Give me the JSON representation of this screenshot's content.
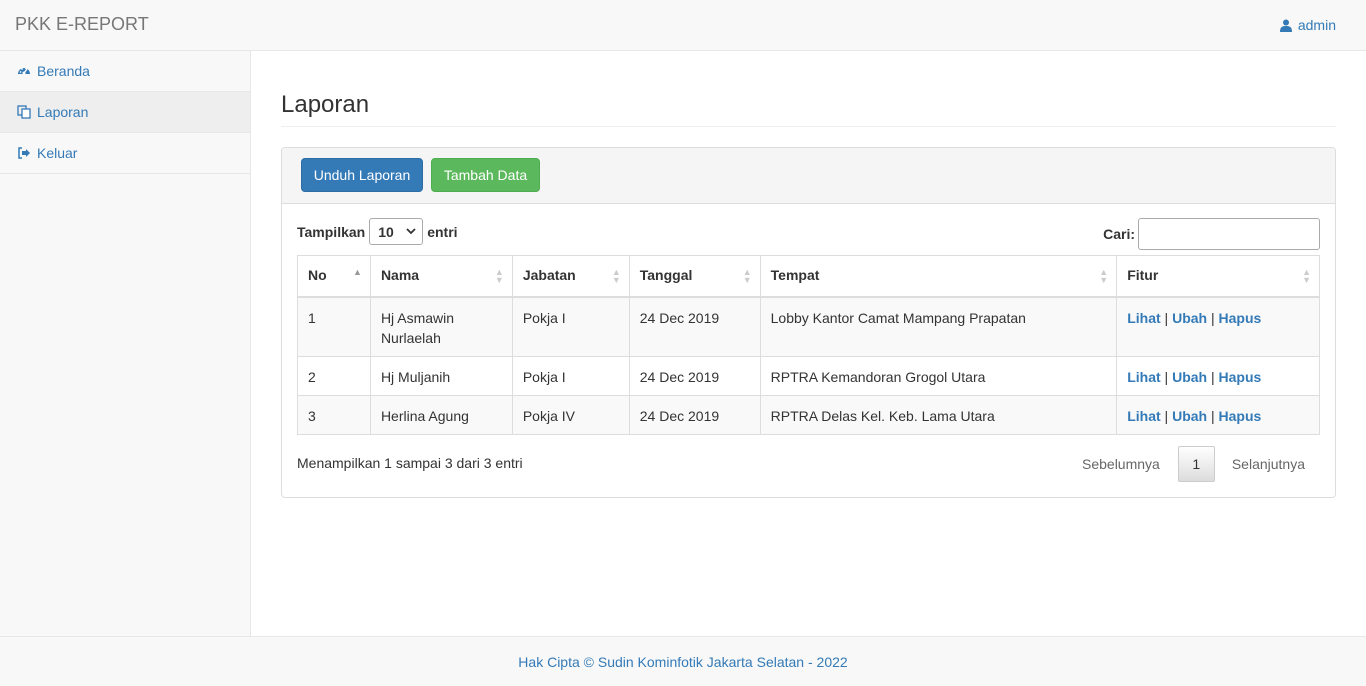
{
  "navbar": {
    "brand": "PKK E-REPORT",
    "user": "admin",
    "user_icon": "user-icon"
  },
  "sidebar": {
    "items": [
      {
        "label": "Beranda",
        "icon": "dashboard-icon"
      },
      {
        "label": "Laporan",
        "icon": "copy-icon"
      },
      {
        "label": "Keluar",
        "icon": "sign-out-icon"
      }
    ]
  },
  "main": {
    "title": "Laporan",
    "buttons": {
      "download": "Unduh Laporan",
      "add": "Tambah Data"
    },
    "length": {
      "label_before": "Tampilkan",
      "value": "10",
      "label_after": "entri"
    },
    "search": {
      "label": "Cari:",
      "value": ""
    },
    "table": {
      "headers": [
        "No",
        "Nama",
        "Jabatan",
        "Tanggal",
        "Tempat",
        "Fitur"
      ],
      "rows": [
        {
          "no": "1",
          "nama": "Hj Asmawin Nurlaelah",
          "jabatan": "Pokja I",
          "tanggal": "24 Dec 2019",
          "tempat": "Lobby Kantor Camat Mampang Prapatan"
        },
        {
          "no": "2",
          "nama": "Hj Muljanih",
          "jabatan": "Pokja I",
          "tanggal": "24 Dec 2019",
          "tempat": "RPTRA Kemandoran Grogol Utara"
        },
        {
          "no": "3",
          "nama": "Herlina Agung",
          "jabatan": "Pokja IV",
          "tanggal": "24 Dec 2019",
          "tempat": "RPTRA Delas Kel. Keb. Lama Utara"
        }
      ],
      "actions": {
        "view": "Lihat",
        "edit": "Ubah",
        "delete": "Hapus",
        "separator": "|"
      }
    },
    "info": "Menampilkan 1 sampai 3 dari 3 entri",
    "pagination": {
      "prev": "Sebelumnya",
      "current": "1",
      "next": "Selanjutnya"
    }
  },
  "footer": {
    "text": "Hak Cipta © Sudin Kominfotik Jakarta Selatan - 2022"
  },
  "colors": {
    "link": "#337ab7",
    "primary": "#337ab7",
    "success": "#5cb85c",
    "navbar_bg": "#f8f8f8"
  }
}
